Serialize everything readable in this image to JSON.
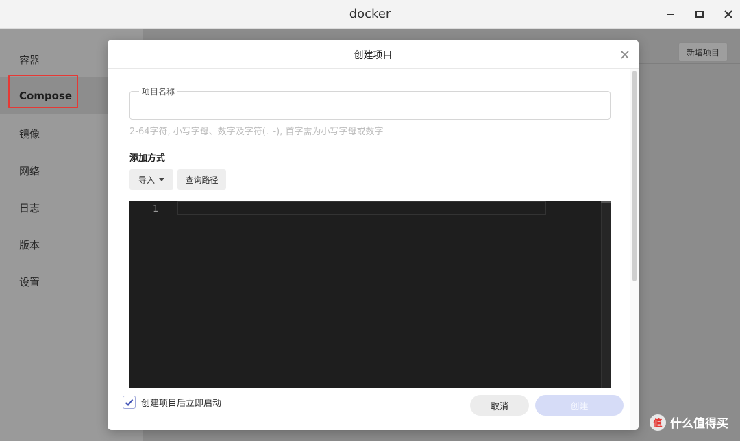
{
  "window": {
    "title": "docker"
  },
  "sidebar": {
    "items": [
      {
        "label": "容器"
      },
      {
        "label": "Compose"
      },
      {
        "label": "镜像"
      },
      {
        "label": "网络"
      },
      {
        "label": "日志"
      },
      {
        "label": "版本"
      },
      {
        "label": "设置"
      }
    ],
    "active_index": 1
  },
  "main": {
    "new_project_label": "新增项目"
  },
  "dialog": {
    "title": "创建项目",
    "project_name": {
      "label": "项目名称",
      "value": "",
      "placeholder": ""
    },
    "hint": "2-64字符, 小写字母、数字及字符(._-), 首字需为小写字母或数字",
    "add_method_label": "添加方式",
    "import_label": "导入",
    "query_path_label": "查询路径",
    "editor": {
      "line_number": "1",
      "content": ""
    },
    "autostart": {
      "label": "创建项目后立即启动",
      "checked": true
    },
    "cancel_label": "取消",
    "create_label": "创建"
  },
  "watermark": {
    "text": "什么值得买",
    "logo_glyph": "值"
  },
  "colors": {
    "accent": "#3f51b5",
    "highlight_border": "#e53935",
    "editor_bg": "#1e1e1e"
  }
}
